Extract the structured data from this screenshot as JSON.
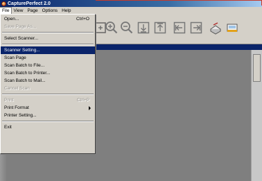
{
  "window": {
    "title": "CapturePerfect 2.0"
  },
  "menubar": {
    "items": [
      {
        "label": "File"
      },
      {
        "label": "View"
      },
      {
        "label": "Page"
      },
      {
        "label": "Options"
      },
      {
        "label": "Help"
      }
    ]
  },
  "file_menu": {
    "items": [
      {
        "label": "Open...",
        "accel": "Ctrl+O",
        "enabled": true
      },
      {
        "label": "Save Page As...",
        "accel": "",
        "enabled": false
      },
      {
        "label": "Select Scanner...",
        "accel": "",
        "enabled": true
      },
      {
        "label": "Scanner Setting...",
        "accel": "",
        "enabled": true,
        "highlighted": true
      },
      {
        "label": "Scan Page",
        "accel": "",
        "enabled": true
      },
      {
        "label": "Scan Batch to File...",
        "accel": "",
        "enabled": true
      },
      {
        "label": "Scan Batch to Printer...",
        "accel": "",
        "enabled": true
      },
      {
        "label": "Scan Batch to Mail...",
        "accel": "",
        "enabled": true
      },
      {
        "label": "Cancel Scan",
        "accel": "",
        "enabled": false
      },
      {
        "label": "Print",
        "accel": "Ctrl+P",
        "enabled": false
      },
      {
        "label": "Print Format",
        "accel": "",
        "enabled": true,
        "submenu": true
      },
      {
        "label": "Printer Setting...",
        "accel": "",
        "enabled": true
      },
      {
        "label": "Exit",
        "accel": "",
        "enabled": true
      }
    ]
  },
  "toolbar": {
    "icons": [
      "zoom-in-icon",
      "zoom-out-icon",
      "page-down-icon",
      "page-up-icon",
      "first-page-icon",
      "last-page-icon",
      "scanner-icon",
      "scanner-alt-icon"
    ]
  },
  "colors": {
    "titlebar": "#0a246a",
    "highlight": "#0a246a",
    "workspace": "#7f7f7f",
    "chrome": "#d4d0c8"
  }
}
